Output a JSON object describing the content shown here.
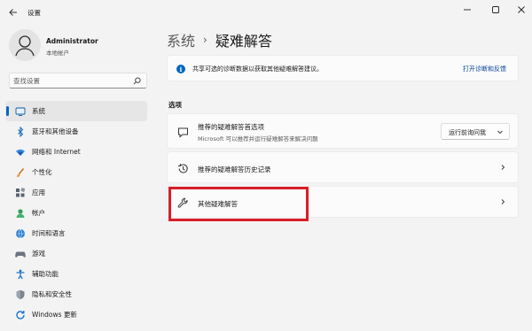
{
  "window": {
    "title": "设置",
    "back_icon": "back-arrow-icon",
    "controls": [
      "minimize-icon",
      "maximize-icon",
      "close-icon"
    ]
  },
  "profile": {
    "name": "Administrator",
    "account_type": "本地帐户"
  },
  "search": {
    "placeholder": "查找设置"
  },
  "sidebar": {
    "items": [
      {
        "label": "系统",
        "icon": "system-icon",
        "active": true
      },
      {
        "label": "蓝牙和其他设备",
        "icon": "bluetooth-icon"
      },
      {
        "label": "网络和 Internet",
        "icon": "network-icon"
      },
      {
        "label": "个性化",
        "icon": "personalization-icon"
      },
      {
        "label": "应用",
        "icon": "apps-icon"
      },
      {
        "label": "帐户",
        "icon": "accounts-icon"
      },
      {
        "label": "时间和语言",
        "icon": "time-language-icon"
      },
      {
        "label": "游戏",
        "icon": "gaming-icon"
      },
      {
        "label": "辅助功能",
        "icon": "accessibility-icon"
      },
      {
        "label": "隐私和安全性",
        "icon": "privacy-shield-icon"
      },
      {
        "label": "Windows 更新",
        "icon": "windows-update-icon"
      }
    ]
  },
  "header": {
    "parent": "系统",
    "separator": "›",
    "current": "疑难解答"
  },
  "info_bar": {
    "text": "共享可选的诊断数据以获取其他疑难解答建议。",
    "link": "打开诊断和反馈"
  },
  "section": {
    "label": "选项"
  },
  "options": {
    "recommended_prefs": {
      "title": "推荐的疑难解答首选项",
      "description": "Microsoft 可以推荐并运行疑难解答来解决问题",
      "dropdown_value": "运行前询问我"
    },
    "history": {
      "title": "推荐的疑难解答历史记录"
    },
    "other": {
      "title": "其他疑难解答"
    }
  },
  "colors": {
    "accent": "#0067c0",
    "highlight": "#d81e28",
    "background": "#f3f3f3",
    "card": "#fbfbfb"
  }
}
